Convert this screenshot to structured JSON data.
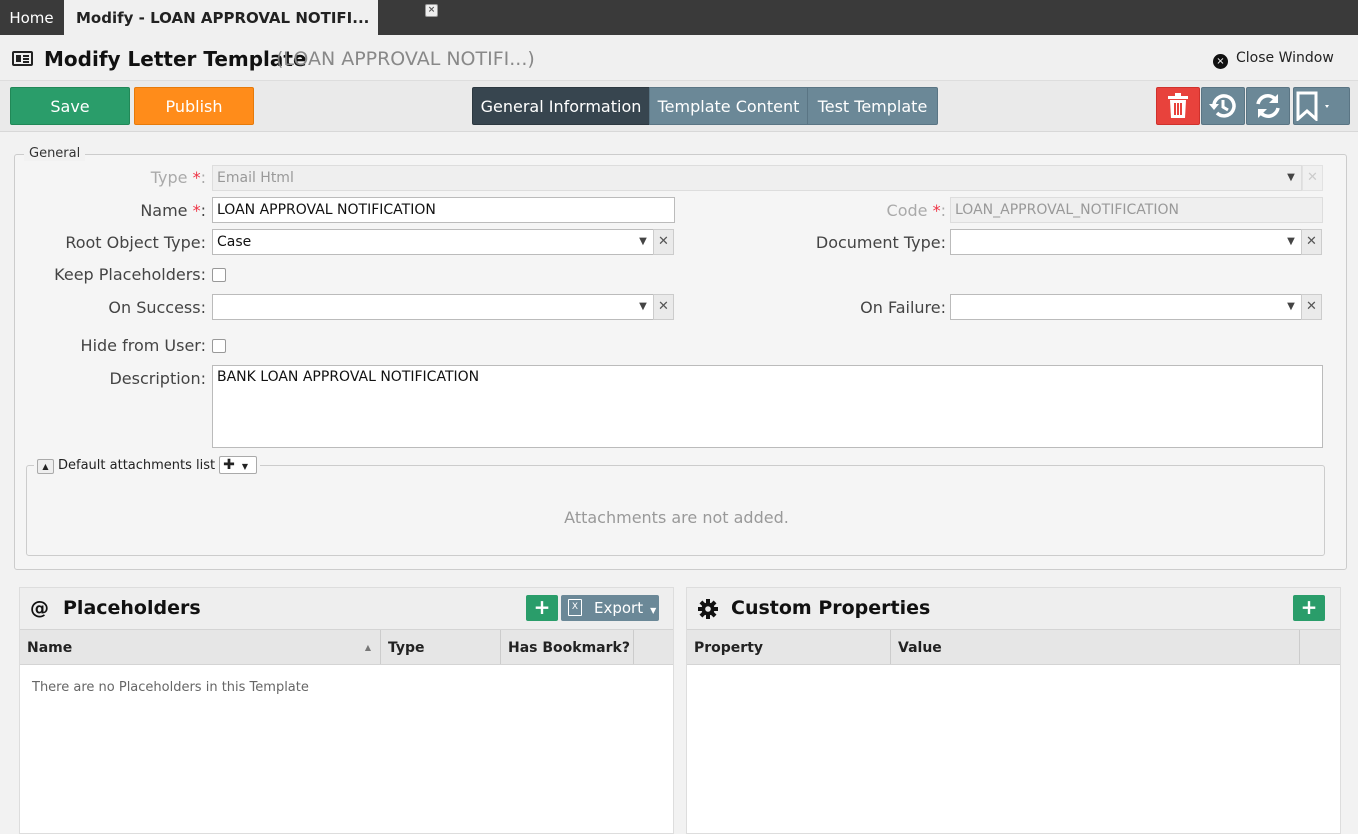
{
  "tabs": {
    "home": "Home",
    "active": "Modify - LOAN APPROVAL NOTIFI...",
    "close": "×"
  },
  "header": {
    "title": "Modify Letter Template",
    "subtitle": "(LOAN APPROVAL NOTIFI...)",
    "close_label": "Close Window",
    "close_icon": "×"
  },
  "toolbar": {
    "save": "Save",
    "publish": "Publish",
    "segments": [
      "General Information",
      "Template Content",
      "Test Template"
    ],
    "active_segment": "General Information"
  },
  "general": {
    "legend": "General",
    "type_label": "Type",
    "type_value": "Email Html",
    "name_label": "Name",
    "name_value": "LOAN APPROVAL NOTIFICATION",
    "code_label": "Code",
    "code_value": "LOAN_APPROVAL_NOTIFICATION",
    "root_label": "Root Object Type:",
    "root_value": "Case",
    "doctype_label": "Document Type:",
    "doctype_value": "",
    "keep_label": "Keep Placeholders:",
    "success_label": "On Success:",
    "success_value": "",
    "failure_label": "On Failure:",
    "failure_value": "",
    "hide_label": "Hide from User:",
    "desc_label": "Description:",
    "desc_value": "BANK LOAN APPROVAL NOTIFICATION",
    "req_mark": "*",
    "colon": ":"
  },
  "attachments": {
    "legend": "Default attachments list",
    "empty": "Attachments are not added."
  },
  "placeholders": {
    "at_icon": "@",
    "title": "Placeholders",
    "export": "Export",
    "columns": [
      "Name",
      "Type",
      "Has Bookmark?"
    ],
    "empty": "There are no Placeholders in this Template"
  },
  "custom": {
    "title": "Custom Properties",
    "columns": [
      "Property",
      "Value"
    ]
  },
  "colors": {
    "green": "#2a9d6a",
    "orange": "#ff8c1a",
    "red": "#e8423c",
    "slate": "#6b8897",
    "dark": "#37454f"
  }
}
